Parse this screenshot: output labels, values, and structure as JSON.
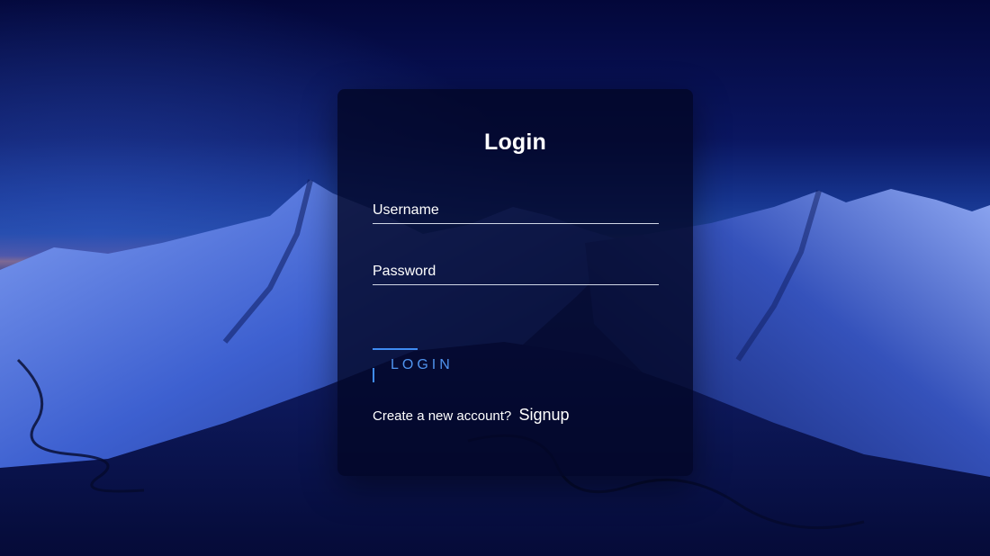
{
  "login_form": {
    "title": "Login",
    "username": {
      "label": "Username",
      "value": ""
    },
    "password": {
      "label": "Password",
      "value": ""
    },
    "submit_label": "LOGIN",
    "signup_prompt": "Create a new account?",
    "signup_link": "Signup"
  },
  "colors": {
    "accent": "#3f8cf2",
    "text": "#ffffff"
  }
}
